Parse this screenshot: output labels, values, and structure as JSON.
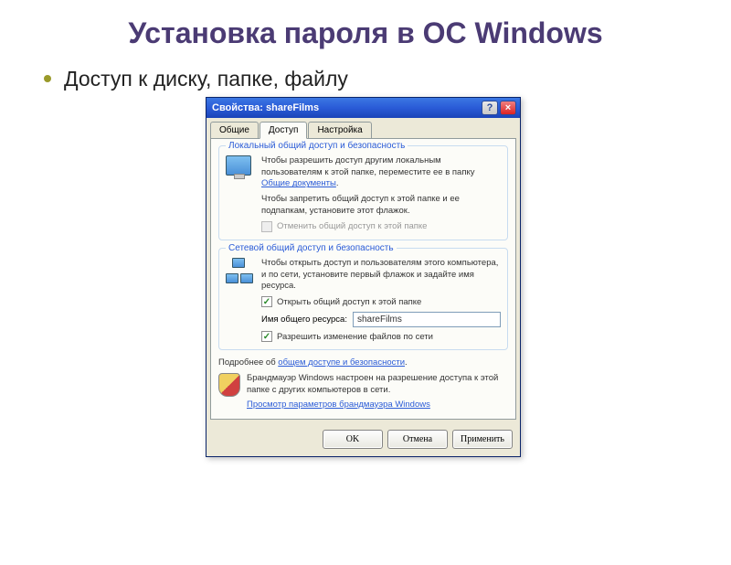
{
  "slide": {
    "title": "Установка пароля в ОС Windows",
    "bullet": "Доступ к диску, папке, файлу"
  },
  "dialog": {
    "title": "Свойства: shareFilms",
    "help_btn": "?",
    "close_btn": "×",
    "tabs": {
      "general": "Общие",
      "access": "Доступ",
      "settings": "Настройка"
    },
    "local": {
      "group_title": "Локальный общий доступ и безопасность",
      "text1_a": "Чтобы разрешить доступ другим локальным пользователям к этой папке, переместите ее в папку ",
      "text1_link": "Общие документы",
      "text1_b": ".",
      "text2": "Чтобы запретить общий доступ к этой папке и ее подпапкам, установите этот флажок.",
      "chk_label": "Отменить общий доступ к этой папке"
    },
    "network": {
      "group_title": "Сетевой общий доступ и безопасность",
      "text1": "Чтобы открыть доступ и пользователям этого компьютера, и по сети, установите первый флажок и задайте имя ресурса.",
      "chk_share": "Открыть общий доступ к этой папке",
      "share_label": "Имя общего ресурса:",
      "share_value": "shareFilms",
      "chk_modify": "Разрешить изменение файлов по сети"
    },
    "more_a": "Подробнее об ",
    "more_link": "общем доступе и безопасности",
    "more_b": ".",
    "firewall": {
      "text": "Брандмауэр Windows настроен на разрешение доступа к этой папке с других компьютеров в сети.",
      "link": "Просмотр параметров брандмауэра Windows"
    },
    "buttons": {
      "ok": "OK",
      "cancel": "Отмена",
      "apply": "Применить"
    }
  }
}
